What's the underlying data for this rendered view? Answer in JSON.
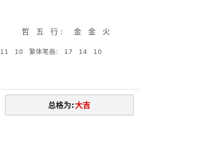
{
  "wuxing": {
    "label": "五 行:",
    "prefix_char": "哲",
    "elements": [
      "金",
      "金",
      "火"
    ]
  },
  "strokes": {
    "leading": [
      "11",
      "10"
    ],
    "label": "繁体笔画:",
    "values": [
      "17",
      "14",
      "10"
    ]
  },
  "result": {
    "label": "总格为:",
    "value": "大吉"
  },
  "colors": {
    "result_value": "#d40000",
    "text": "#555555",
    "box_bg": "#f3f3f3",
    "box_border": "#cfcfcf"
  }
}
